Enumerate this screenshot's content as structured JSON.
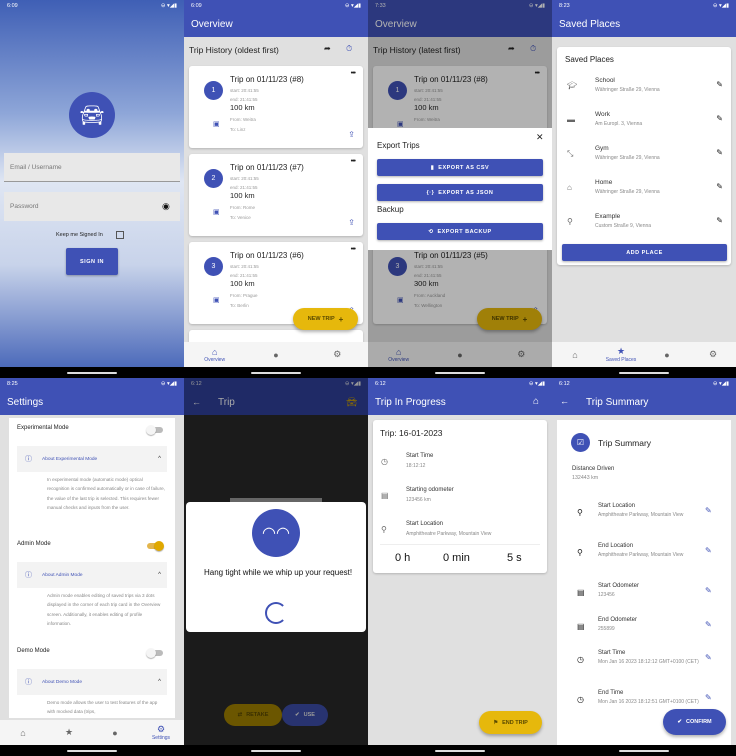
{
  "colors": {
    "primary": "#3f51b5",
    "accent": "#e6b80c",
    "background": "#e0e0e0"
  },
  "login": {
    "status_time": "6:09",
    "email_placeholder": "Email / Username",
    "password_placeholder": "Password",
    "keep_signed_in": "Keep me Signed In",
    "keep_signed_in_checked": false,
    "sign_in": "SIGN IN"
  },
  "overview_oldest": {
    "status_time": "6:09",
    "title": "Overview",
    "section": "Trip History (oldest first)",
    "trips": [
      {
        "n": "1",
        "title": "Trip on 01/11/23 (#8)",
        "start": "start: 20:41:55",
        "end": "end: 21:41:55",
        "km": "100 km",
        "from": "From: Weitra",
        "to": "To: Linz"
      },
      {
        "n": "2",
        "title": "Trip on 01/11/23 (#7)",
        "start": "start: 20:41:55",
        "end": "end: 21:41:55",
        "km": "100 km",
        "from": "From: Rome",
        "to": "To: Venice"
      },
      {
        "n": "3",
        "title": "Trip on 01/11/23 (#6)",
        "start": "start: 20:41:55",
        "end": "end: 21:41:55",
        "km": "100 km",
        "from": "From: Prague",
        "to": "To: Berlin"
      }
    ],
    "fab": "NEW TRIP",
    "nav": {
      "overview": "Overview"
    }
  },
  "overview_export": {
    "status_time": "7:33",
    "title": "Overview",
    "section": "Trip History (latest first)",
    "trips": [
      {
        "n": "1",
        "title": "Trip on 01/11/23 (#8)",
        "start": "start: 20:41:55",
        "end": "end: 21:41:55",
        "km": "100 km",
        "from": "From: Weitra"
      },
      {
        "n": "3",
        "title": "Trip on 01/11/23 (#5)",
        "start": "start: 20:41:55",
        "end": "end: 21:41:55",
        "km": "300 km",
        "from": "From: Auckland",
        "to": "To: Wellington"
      }
    ],
    "sheet": {
      "export_title": "Export Trips",
      "csv": "EXPORT AS CSV",
      "json": "EXPORT AS JSON",
      "backup_title": "Backup",
      "backup": "EXPORT BACKUP"
    },
    "fab": "NEW TRIP",
    "nav": {
      "overview": "Overview"
    }
  },
  "places": {
    "status_time": "8:23",
    "title": "Saved Places",
    "card_title": "Saved Places",
    "items": [
      {
        "name": "School",
        "address": "Währinger Straße 29, Vienna",
        "icon": "school-icon"
      },
      {
        "name": "Work",
        "address": "Am Europl. 3, Vienna",
        "icon": "briefcase-icon"
      },
      {
        "name": "Gym",
        "address": "Währinger Straße 29, Vienna",
        "icon": "fitness-icon"
      },
      {
        "name": "Home",
        "address": "Währinger Straße 29, Vienna",
        "icon": "home-icon"
      },
      {
        "name": "Example",
        "address": "Custom Straße 9, Vienna",
        "icon": "pin-icon"
      }
    ],
    "add": "ADD PLACE",
    "nav": {
      "saved": "Saved Places"
    }
  },
  "settings": {
    "status_time": "8:25",
    "title": "Settings",
    "modes": [
      {
        "label": "Experimental Mode",
        "on": false,
        "about": "About Experimental Mode",
        "desc": "In experimental mode (automatic mode) optical recognition is confirmed automatically or in case of failure, the value of the last trip is selected. This requires fewer manual checks and inputs from the user."
      },
      {
        "label": "Admin Mode",
        "on": true,
        "about": "About Admin Mode",
        "desc": "Admin mode enables editing of saved trips via 3 dots displayed in the corner of each trip card in the Overview screen. Additionally, it enables editing of profile information."
      },
      {
        "label": "Demo Mode",
        "on": false,
        "about": "About Demo Mode",
        "desc": "Demo mode allows the user to test features of the app with mocked data (trips,"
      }
    ],
    "nav": {
      "settings": "Settings"
    }
  },
  "trip_loading": {
    "status_time": "6:12",
    "title": "Trip",
    "message": "Hang tight while we whip up your request!",
    "retake": "RETAKE",
    "use": "USE"
  },
  "trip_progress": {
    "status_time": "6:12",
    "title": "Trip In Progress",
    "trip": "Trip: 16-01-2023",
    "rows": [
      {
        "label": "Start Time",
        "value": "18:12:12"
      },
      {
        "label": "Starting odometer",
        "value": "123456 km"
      },
      {
        "label": "Start Location",
        "value": "Amphitheatre Parkway, Mountain View"
      }
    ],
    "h": "0 h",
    "min": "0 min",
    "s": "5 s",
    "end": "END TRIP"
  },
  "summary": {
    "status_time": "6:12",
    "title": "Trip Summary",
    "card_title": "Trip Summary",
    "distance_label": "Distance Driven",
    "distance": "132443 km",
    "rows": [
      {
        "label": "Start Location",
        "value": "Amphitheatre Parkway, Mountain View",
        "icon": "pin-icon"
      },
      {
        "label": "End Location",
        "value": "Amphitheatre Parkway, Mountain View",
        "icon": "pin-icon"
      },
      {
        "label": "Start Odometer",
        "value": "123456",
        "icon": "odometer-icon"
      },
      {
        "label": "End Odometer",
        "value": "255899",
        "icon": "odometer-icon"
      },
      {
        "label": "Start Time",
        "value": "Mon Jan 16 2023 18:12:12 GMT+0100 (CET)",
        "icon": "clock-icon"
      },
      {
        "label": "End Time",
        "value": "Mon Jan 16 2023 18:12:51 GMT+0100 (CET)",
        "icon": "clock-icon"
      }
    ],
    "confirm": "CONFIRM"
  }
}
